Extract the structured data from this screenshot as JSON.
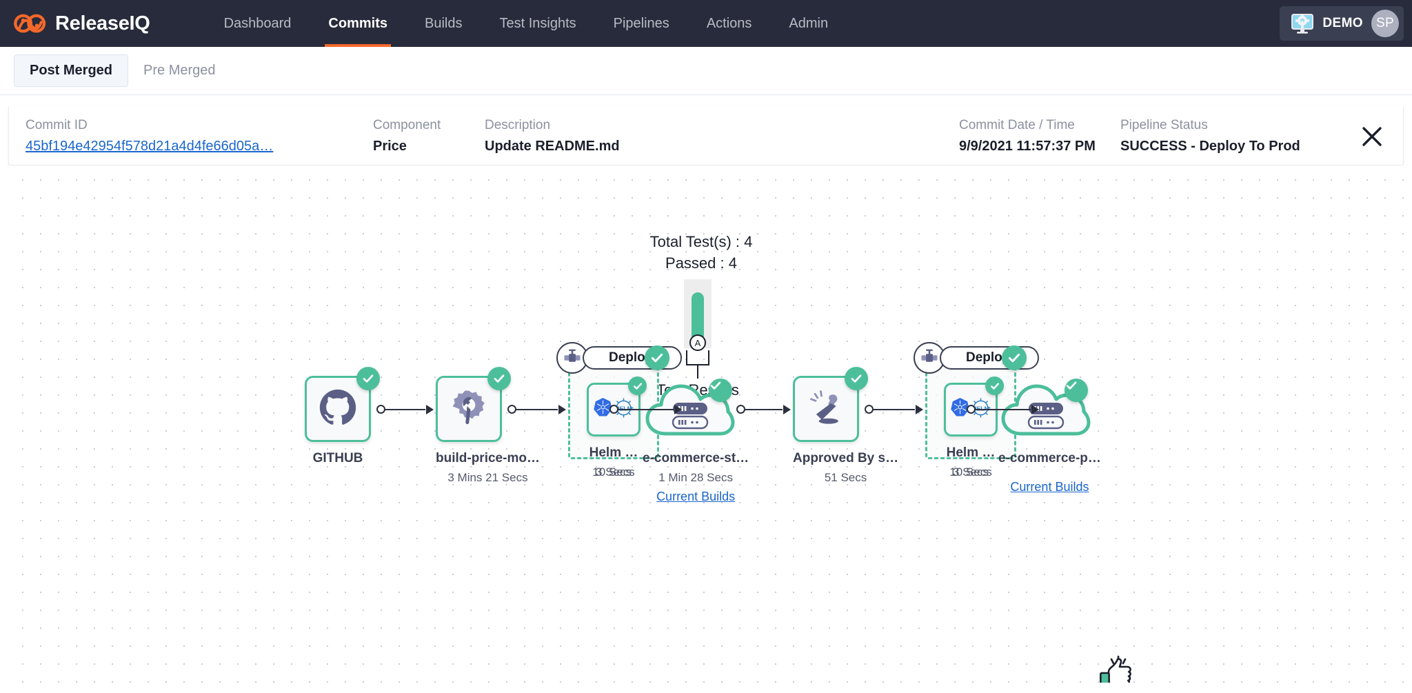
{
  "app": {
    "brand": "ReleaseIQ",
    "brand_logo_icon": "releaseiq-logo-icon",
    "accent_color": "#f4682a",
    "nav_bg_color": "#272b3b",
    "success_color": "#4cbf9a",
    "link_color": "#1a66cc"
  },
  "nav": {
    "items": [
      {
        "label": "Dashboard",
        "active": false
      },
      {
        "label": "Commits",
        "active": true
      },
      {
        "label": "Builds",
        "active": false
      },
      {
        "label": "Test Insights",
        "active": false
      },
      {
        "label": "Pipelines",
        "active": false
      },
      {
        "label": "Actions",
        "active": false
      },
      {
        "label": "Admin",
        "active": false
      }
    ],
    "demo_label": "DEMO",
    "demo_icon": "monitor-gear-icon",
    "avatar_initials": "SP"
  },
  "subtabs": [
    {
      "label": "Post Merged",
      "active": true
    },
    {
      "label": "Pre Merged",
      "active": false
    }
  ],
  "info": {
    "commit_id_label": "Commit ID",
    "commit_id_value": "45bf194e42954f578d21a4d4fe66d05a…",
    "component_label": "Component",
    "component_value": "Price",
    "description_label": "Description",
    "description_value": "Update README.md",
    "date_label": "Commit Date / Time",
    "date_value": "9/9/2021 11:57:37 PM",
    "status_label": "Pipeline Status",
    "status_value": "SUCCESS - Deploy To Prod",
    "close_icon": "close-icon"
  },
  "test_results": {
    "total_line": "Total Test(s) : 4",
    "passed_line": "Passed : 4",
    "caption": "Test Results",
    "marker": "A",
    "total": 4,
    "passed": 4,
    "pass_ratio_percent": 100
  },
  "pipeline": {
    "nodes": [
      {
        "id": "github",
        "icon": "github-icon",
        "title": "GITHUB",
        "duration": "",
        "link": "",
        "status": "success"
      },
      {
        "id": "build-price-module",
        "icon": "build-gear-wrench-icon",
        "title": "build-price-mo…",
        "duration": "3 Mins 21 Secs",
        "link": "",
        "status": "success"
      },
      {
        "id": "e-commerce-stage",
        "icon": "cloud-server-icon",
        "title": "e-commerce-st…",
        "duration": "1 Min 28 Secs",
        "link": "Current Builds",
        "status": "success"
      },
      {
        "id": "approved-by",
        "icon": "approval-stamp-icon",
        "title": "Approved By s…",
        "duration": "51 Secs",
        "link": "",
        "status": "success"
      },
      {
        "id": "e-commerce-prod",
        "icon": "cloud-server-icon",
        "title": "e-commerce-p…",
        "duration": "",
        "link": "Current Builds",
        "status": "success"
      }
    ],
    "groups": [
      {
        "id": "deploy-stage",
        "header": "Deploy …",
        "header_icon": "pipe-valve-icon",
        "duration": "10 Secs",
        "status": "success",
        "child": {
          "icon": "kubernetes-helm-icon",
          "title": "Helm …",
          "duration": "3 Secs",
          "status": "success"
        }
      },
      {
        "id": "deploy-prod",
        "header": "Deploy …",
        "header_icon": "pipe-valve-icon",
        "duration": "10 Secs",
        "status": "success",
        "child": {
          "icon": "kubernetes-helm-icon",
          "title": "Helm …",
          "duration": "3 Secs",
          "status": "success"
        }
      }
    ],
    "end_marker_icon": "thumbs-up-icon"
  }
}
